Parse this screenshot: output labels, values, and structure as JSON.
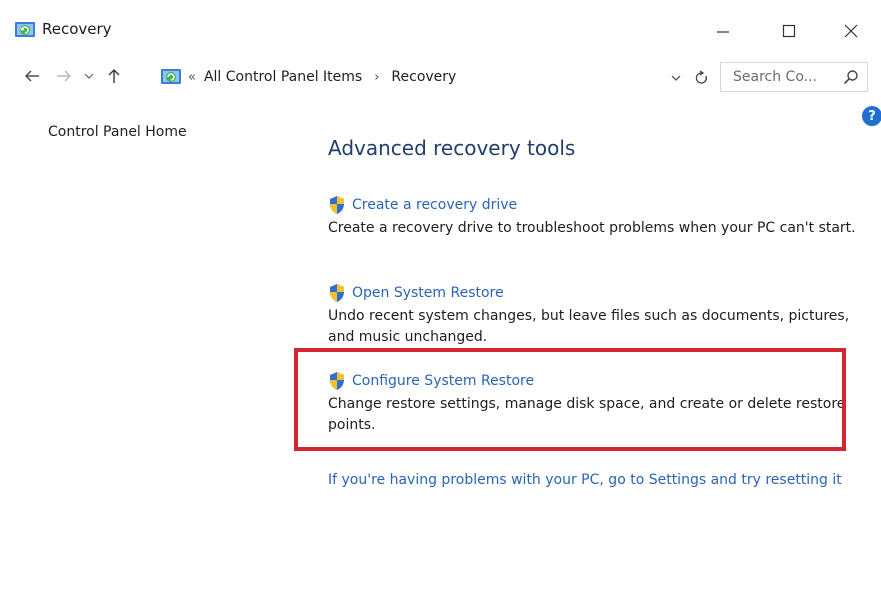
{
  "window": {
    "title": "Recovery",
    "minimize_label": "—",
    "maximize_label": "☐",
    "close_label": "✕"
  },
  "navigation": {
    "back_icon": "arrow-left-icon",
    "forward_icon": "arrow-right-icon",
    "recent_icon": "chevron-down-icon",
    "up_icon": "arrow-up-icon",
    "address": {
      "overflow_chevron": "«",
      "crumbs": [
        "All Control Panel Items",
        "Recovery"
      ],
      "separator": "›"
    },
    "search": {
      "placeholder": "Search Co..."
    }
  },
  "help": {
    "label": "?"
  },
  "left_nav": {
    "items": [
      {
        "label": "Control Panel Home"
      }
    ]
  },
  "main": {
    "heading": "Advanced recovery tools",
    "tools": [
      {
        "link": "Create a recovery drive",
        "description": "Create a recovery drive to troubleshoot problems when your PC can't start."
      },
      {
        "link": "Open System Restore",
        "description": "Undo recent system changes, but leave files such as documents, pictures, and music unchanged."
      },
      {
        "link": "Configure System Restore",
        "description": "Change restore settings, manage disk space, and create or delete restore points.",
        "highlighted": true
      }
    ],
    "reset_link": "If you're having problems with your PC, go to Settings and try resetting it"
  },
  "colors": {
    "link": "#2a64b8",
    "heading": "#1f3f6b",
    "highlight_border": "#d32832",
    "help_badge": "#1e6fd0"
  }
}
